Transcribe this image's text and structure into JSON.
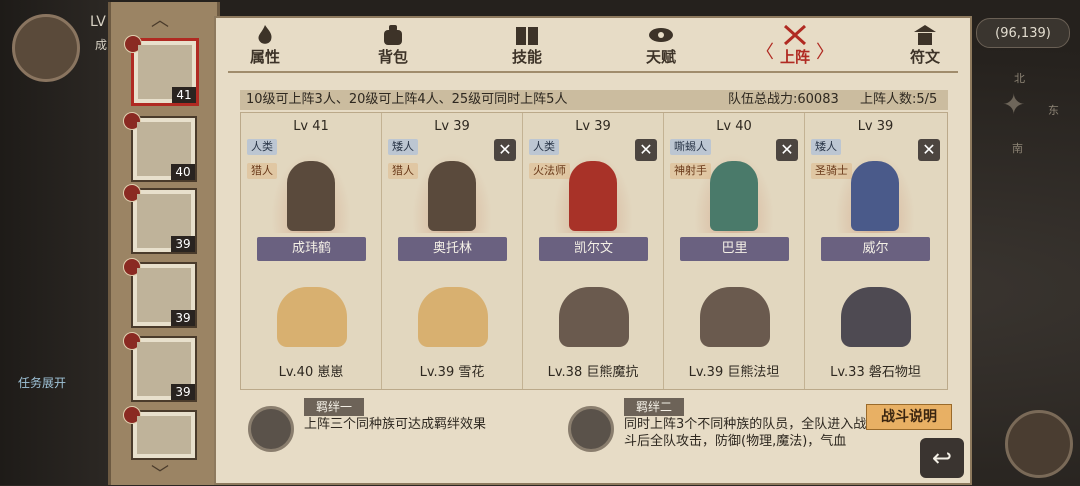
{
  "hud": {
    "player_level_text": "LV",
    "player_name_partial": "成",
    "task_expand": "任务展开",
    "coords": "(96,139)",
    "compass": {
      "north": "北",
      "east": "东",
      "south": "南"
    }
  },
  "roster": [
    {
      "level": "41",
      "selected": true
    },
    {
      "level": "40",
      "selected": false
    },
    {
      "level": "39",
      "selected": false
    },
    {
      "level": "39",
      "selected": false
    },
    {
      "level": "39",
      "selected": false
    },
    {
      "level": "",
      "selected": false
    }
  ],
  "tabs": [
    {
      "label": "属性",
      "icon": "flame-icon",
      "active": false
    },
    {
      "label": "背包",
      "icon": "bag-icon",
      "active": false
    },
    {
      "label": "技能",
      "icon": "book-icon",
      "active": false
    },
    {
      "label": "天赋",
      "icon": "eye-icon",
      "active": false
    },
    {
      "label": "上阵",
      "icon": "crossed-swords-icon",
      "active": true
    },
    {
      "label": "符文",
      "icon": "shrine-icon",
      "active": false
    }
  ],
  "info": {
    "rule": "10级可上阵3人、20级可上阵4人、25级可同时上阵5人",
    "power": "队伍总战力:60083",
    "count": "上阵人数:5/5"
  },
  "lineup": [
    {
      "level": "Lv 41",
      "race": "人类",
      "job": "猎人",
      "name": "成玮鹤",
      "pet": "Lv.40 崽崽",
      "removable": false
    },
    {
      "level": "Lv 39",
      "race": "矮人",
      "job": "猎人",
      "name": "奥托林",
      "pet": "Lv.39 雪花",
      "removable": true
    },
    {
      "level": "Lv 39",
      "race": "人类",
      "job": "火法师",
      "name": "凯尔文",
      "pet": "Lv.38 巨熊魔抗",
      "removable": true
    },
    {
      "level": "Lv 40",
      "race": "嘶蜴人",
      "job": "神射手",
      "name": "巴里",
      "pet": "Lv.39 巨熊法坦",
      "removable": true
    },
    {
      "level": "Lv 39",
      "race": "矮人",
      "job": "圣骑士",
      "name": "威尔",
      "pet": "Lv.33 磐石物坦",
      "removable": true
    }
  ],
  "close_glyph": "✕",
  "bonds": [
    {
      "title": "羁绊一",
      "desc": "上阵三个同种族可达成羁绊效果"
    },
    {
      "title": "羁绊二",
      "desc": "同时上阵3个不同种族的队员，全队进入战斗后全队攻击，防御(物理,魔法)，气血"
    }
  ],
  "battle_button": "战斗说明",
  "back_glyph": "↩"
}
